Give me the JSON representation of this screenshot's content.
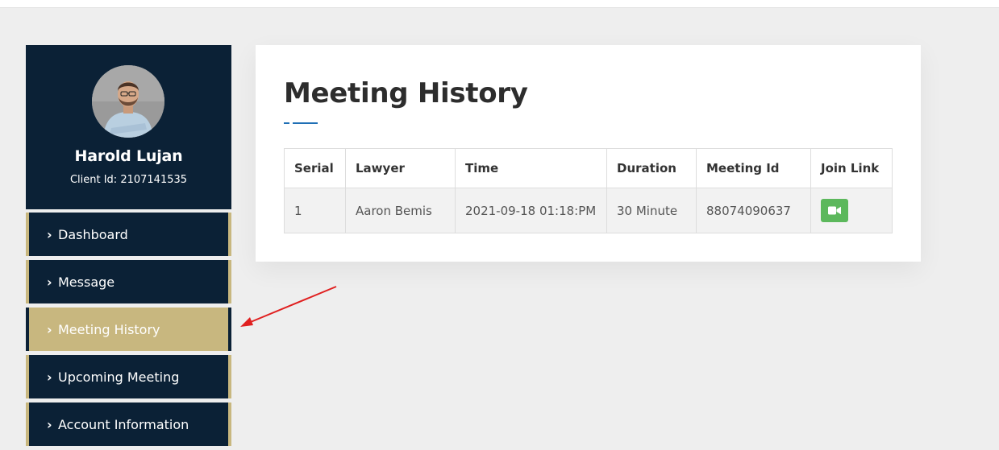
{
  "profile": {
    "name": "Harold Lujan",
    "client_id": "Client Id: 2107141535"
  },
  "nav": {
    "items": [
      {
        "label": "Dashboard",
        "active": false
      },
      {
        "label": "Message",
        "active": false
      },
      {
        "label": "Meeting History",
        "active": true
      },
      {
        "label": "Upcoming Meeting",
        "active": false
      },
      {
        "label": "Account Information",
        "active": false
      }
    ],
    "chevron_icon": "chevron-right-icon"
  },
  "main": {
    "title": "Meeting History",
    "table": {
      "headers": [
        "Serial",
        "Lawyer",
        "Time",
        "Duration",
        "Meeting Id",
        "Join Link"
      ],
      "rows": [
        {
          "serial": "1",
          "lawyer": "Aaron Bemis",
          "time": "2021-09-18 01:18:PM",
          "duration": "30 Minute",
          "meeting_id": "88074090637",
          "join_icon": "video-camera-icon"
        }
      ]
    }
  },
  "colors": {
    "sidebar_bg": "#0b2136",
    "accent_gold": "#c8b77f",
    "join_button": "#5cb85c",
    "title_underline": "#1f6fb5",
    "annotation_arrow": "#e02020"
  }
}
